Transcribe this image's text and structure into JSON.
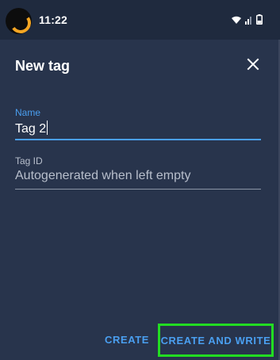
{
  "status_bar": {
    "time": "11:22",
    "icons": [
      "wifi-icon",
      "signal-icon",
      "battery-icon"
    ]
  },
  "dialog": {
    "title": "New tag",
    "close_icon": "close-icon"
  },
  "form": {
    "name": {
      "label": "Name",
      "value": "Tag 2"
    },
    "tag_id": {
      "label": "Tag ID",
      "placeholder": "Autogenerated when left empty",
      "value": ""
    }
  },
  "actions": {
    "create_label": "CREATE",
    "create_and_write_label": "CREATE AND WRITE"
  },
  "colors": {
    "background": "#28344c",
    "status_bar": "#1f2a3e",
    "accent": "#4a9ff0",
    "highlight": "#22dd22",
    "muted_text": "#b8bfcc"
  }
}
